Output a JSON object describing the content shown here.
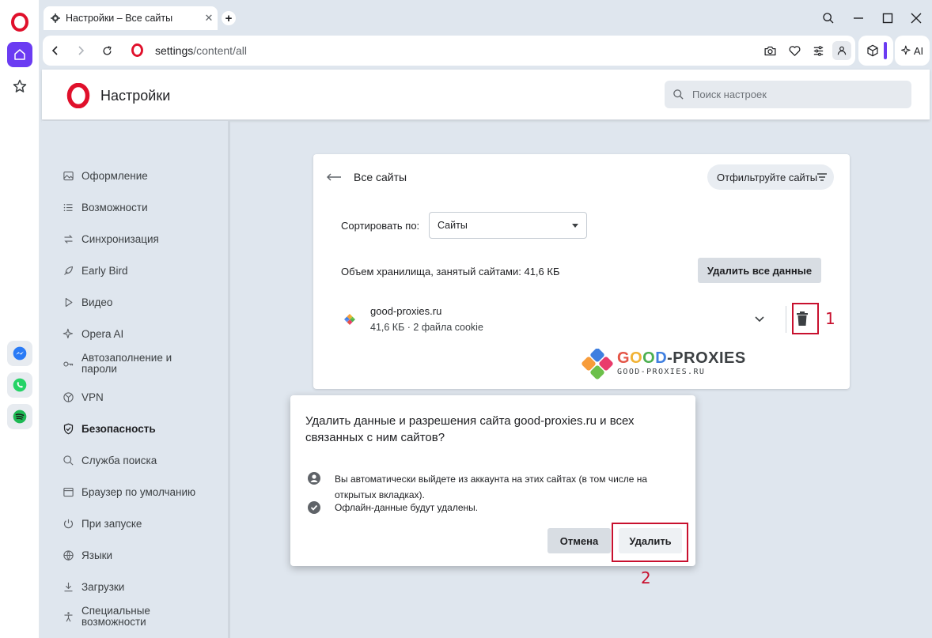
{
  "browser": {
    "tab_title": "Настройки – Все сайты",
    "url_host": "settings",
    "url_path": "/content/all",
    "ai_label": "AI",
    "accent_color": "#6b3cf2"
  },
  "settings": {
    "header_title": "Настройки",
    "search_placeholder": "Поиск настроек",
    "nav": [
      {
        "label": "Оформление",
        "icon": "image-icon"
      },
      {
        "label": "Возможности",
        "icon": "list-icon"
      },
      {
        "label": "Синхронизация",
        "icon": "sync-icon"
      },
      {
        "label": "Early Bird",
        "icon": "bird-icon"
      },
      {
        "label": "Видео",
        "icon": "play-icon"
      },
      {
        "label": "Opera AI",
        "icon": "sparkle-icon"
      },
      {
        "label": "Автозаполнение и пароли",
        "icon": "key-icon"
      },
      {
        "label": "VPN",
        "icon": "vpn-icon"
      },
      {
        "label": "Безопасность",
        "icon": "shield-icon",
        "active": true
      },
      {
        "label": "Служба поиска",
        "icon": "search-icon"
      },
      {
        "label": "Браузер по умолчанию",
        "icon": "browser-icon"
      },
      {
        "label": "При запуске",
        "icon": "power-icon"
      },
      {
        "label": "Языки",
        "icon": "globe-icon"
      },
      {
        "label": "Загрузки",
        "icon": "download-icon"
      },
      {
        "label": "Специальные возможности",
        "icon": "accessibility-icon"
      }
    ]
  },
  "all_sites": {
    "title": "Все сайты",
    "filter_label": "Отфильтруйте сайты",
    "sort_label": "Сортировать по:",
    "sort_value": "Сайты",
    "storage_text": "Объем хранилища, занятый сайтами: 41,6 КБ",
    "delete_all_label": "Удалить все данные",
    "site": {
      "name": "good-proxies.ru",
      "meta": "41,6 КБ · 2 файла cookie"
    }
  },
  "annotations": {
    "step1": "1",
    "step2": "2",
    "highlight_color": "#c8102e"
  },
  "watermark": {
    "name_part1": "G",
    "name_part2": "O",
    "name_part3": "O",
    "name_part4": "D",
    "name_rest": "-PROXIES",
    "url": "GOOD-PROXIES.RU"
  },
  "dialog": {
    "title": "Удалить данные и разрешения сайта good-proxies.ru и всех связанных с ним сайтов?",
    "line1": "Вы автоматически выйдете из аккаунта на этих сайтах (в том числе на открытых вкладках).",
    "line2": "Офлайн-данные будут удалены.",
    "cancel_label": "Отмена",
    "delete_label": "Удалить"
  }
}
